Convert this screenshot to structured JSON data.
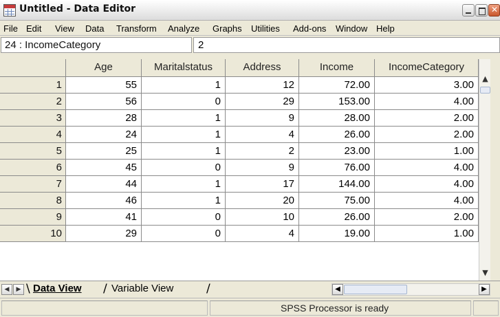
{
  "window": {
    "title": "Untitled - Data Editor"
  },
  "menu": [
    "File",
    "Edit",
    "View",
    "Data",
    "Transform",
    "Analyze",
    "Graphs",
    "Utilities",
    "Add-ons",
    "Window",
    "Help"
  ],
  "editor": {
    "cell_ref": "24 : IncomeCategory",
    "cell_value": "2"
  },
  "grid": {
    "columns": [
      "Age",
      "Maritalstatus",
      "Address",
      "Income",
      "IncomeCategory"
    ],
    "rows": [
      {
        "n": "1",
        "cells": [
          "55",
          "1",
          "12",
          "72.00",
          "3.00"
        ]
      },
      {
        "n": "2",
        "cells": [
          "56",
          "0",
          "29",
          "153.00",
          "4.00"
        ]
      },
      {
        "n": "3",
        "cells": [
          "28",
          "1",
          "9",
          "28.00",
          "2.00"
        ]
      },
      {
        "n": "4",
        "cells": [
          "24",
          "1",
          "4",
          "26.00",
          "2.00"
        ]
      },
      {
        "n": "5",
        "cells": [
          "25",
          "1",
          "2",
          "23.00",
          "1.00"
        ]
      },
      {
        "n": "6",
        "cells": [
          "45",
          "0",
          "9",
          "76.00",
          "4.00"
        ]
      },
      {
        "n": "7",
        "cells": [
          "44",
          "1",
          "17",
          "144.00",
          "4.00"
        ]
      },
      {
        "n": "8",
        "cells": [
          "46",
          "1",
          "20",
          "75.00",
          "4.00"
        ]
      },
      {
        "n": "9",
        "cells": [
          "41",
          "0",
          "10",
          "26.00",
          "2.00"
        ]
      },
      {
        "n": "10",
        "cells": [
          "29",
          "0",
          "4",
          "19.00",
          "1.00"
        ]
      }
    ]
  },
  "tabs": {
    "data_view": "Data View",
    "variable_view": "Variable View"
  },
  "status": {
    "text": "SPSS Processor  is ready"
  }
}
